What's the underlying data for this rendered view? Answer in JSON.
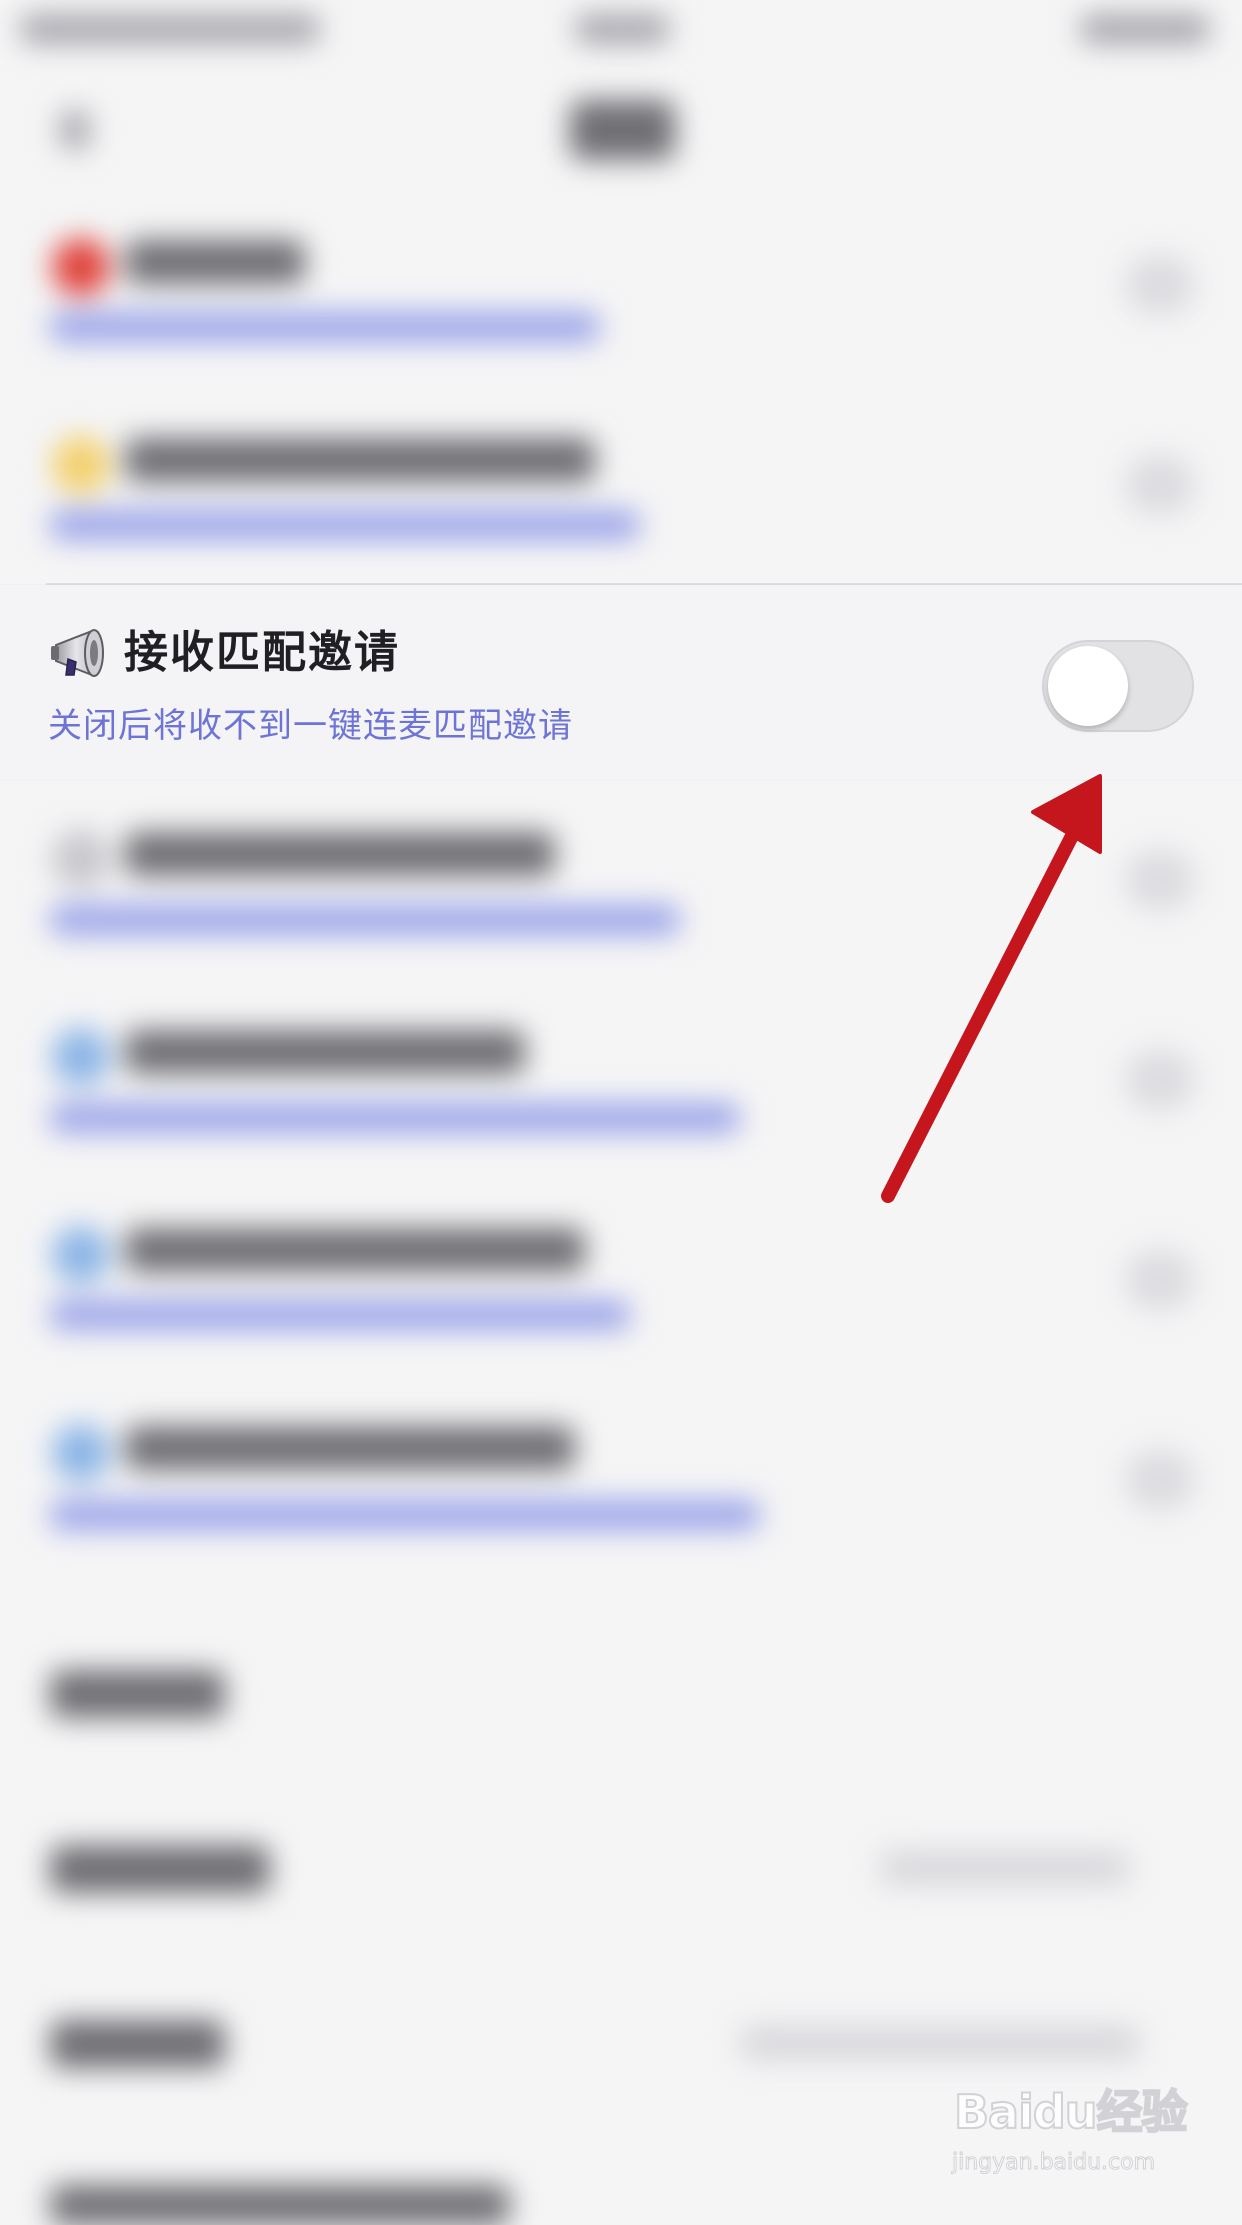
{
  "setting": {
    "title": "接收匹配邀请",
    "subtitle": "关闭后将收不到一键连麦匹配邀请",
    "icon": "megaphone-icon",
    "enabled": false
  },
  "watermark": {
    "logo": "Baidu经验",
    "url": "jingyan.baidu.com"
  },
  "colors": {
    "background": "#f5f5f6",
    "subtitle": "#6d74d6",
    "toggle_off": "#e2e2e5",
    "arrow": "#c4161c"
  }
}
